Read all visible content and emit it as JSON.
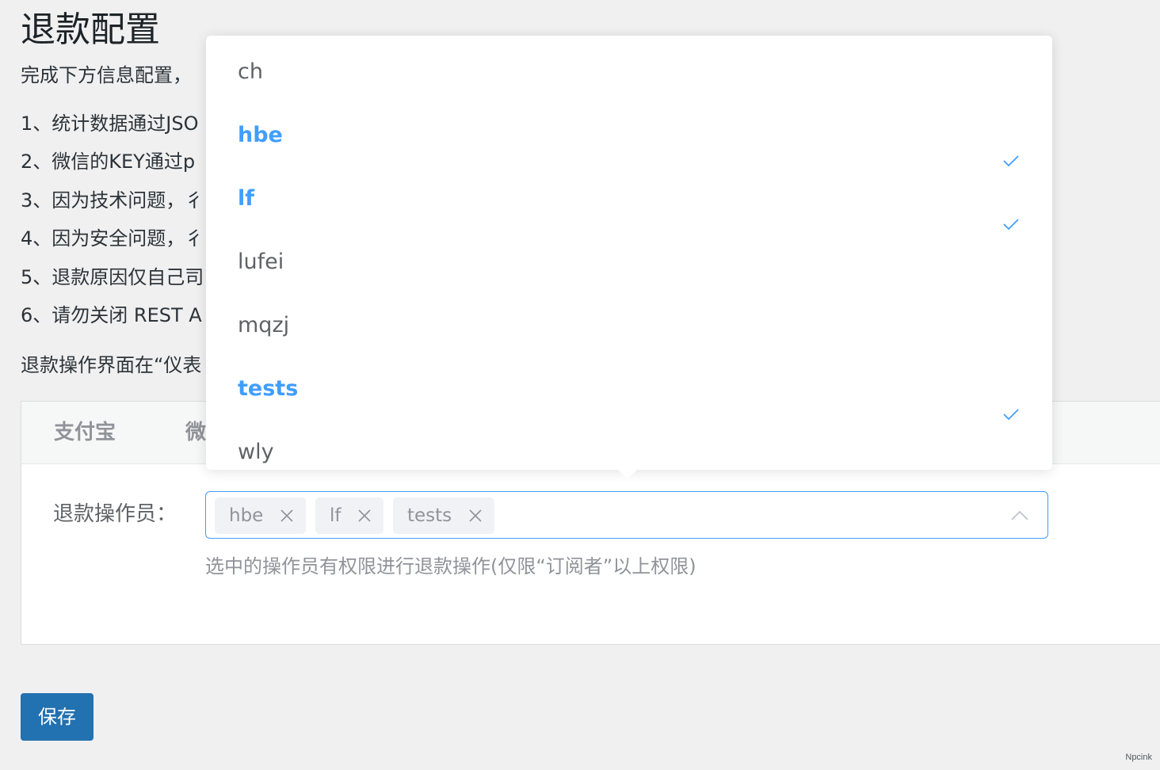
{
  "page": {
    "title": "退款配置",
    "intro": "完成下方信息配置，",
    "notes": [
      "1、统计数据通过JSO",
      "2、微信的KEY通过p",
      "3、因为技术问题，彳",
      "4、因为安全问题，彳",
      "5、退款原因仅自己司",
      "6、请勿关闭 REST A"
    ],
    "location_note": "退款操作界面在“仪表"
  },
  "tabs": [
    "支付宝",
    "微"
  ],
  "form": {
    "label": "退款操作员：",
    "selected_tags": [
      "hbe",
      "lf",
      "tests"
    ],
    "help_text": "选中的操作员有权限进行退款操作(仅限“订阅者”以上权限)"
  },
  "dropdown": {
    "options": [
      {
        "label": "ch",
        "selected": false
      },
      {
        "label": "hbe",
        "selected": true
      },
      {
        "label": "lf",
        "selected": true
      },
      {
        "label": "lufei",
        "selected": false
      },
      {
        "label": "mqzj",
        "selected": false
      },
      {
        "label": "tests",
        "selected": true
      },
      {
        "label": "wly",
        "selected": false
      }
    ]
  },
  "actions": {
    "save_label": "保存"
  },
  "watermark": "Npcink",
  "colors": {
    "accent": "#409eff",
    "button": "#2271b1",
    "background": "#f0f0f1"
  }
}
